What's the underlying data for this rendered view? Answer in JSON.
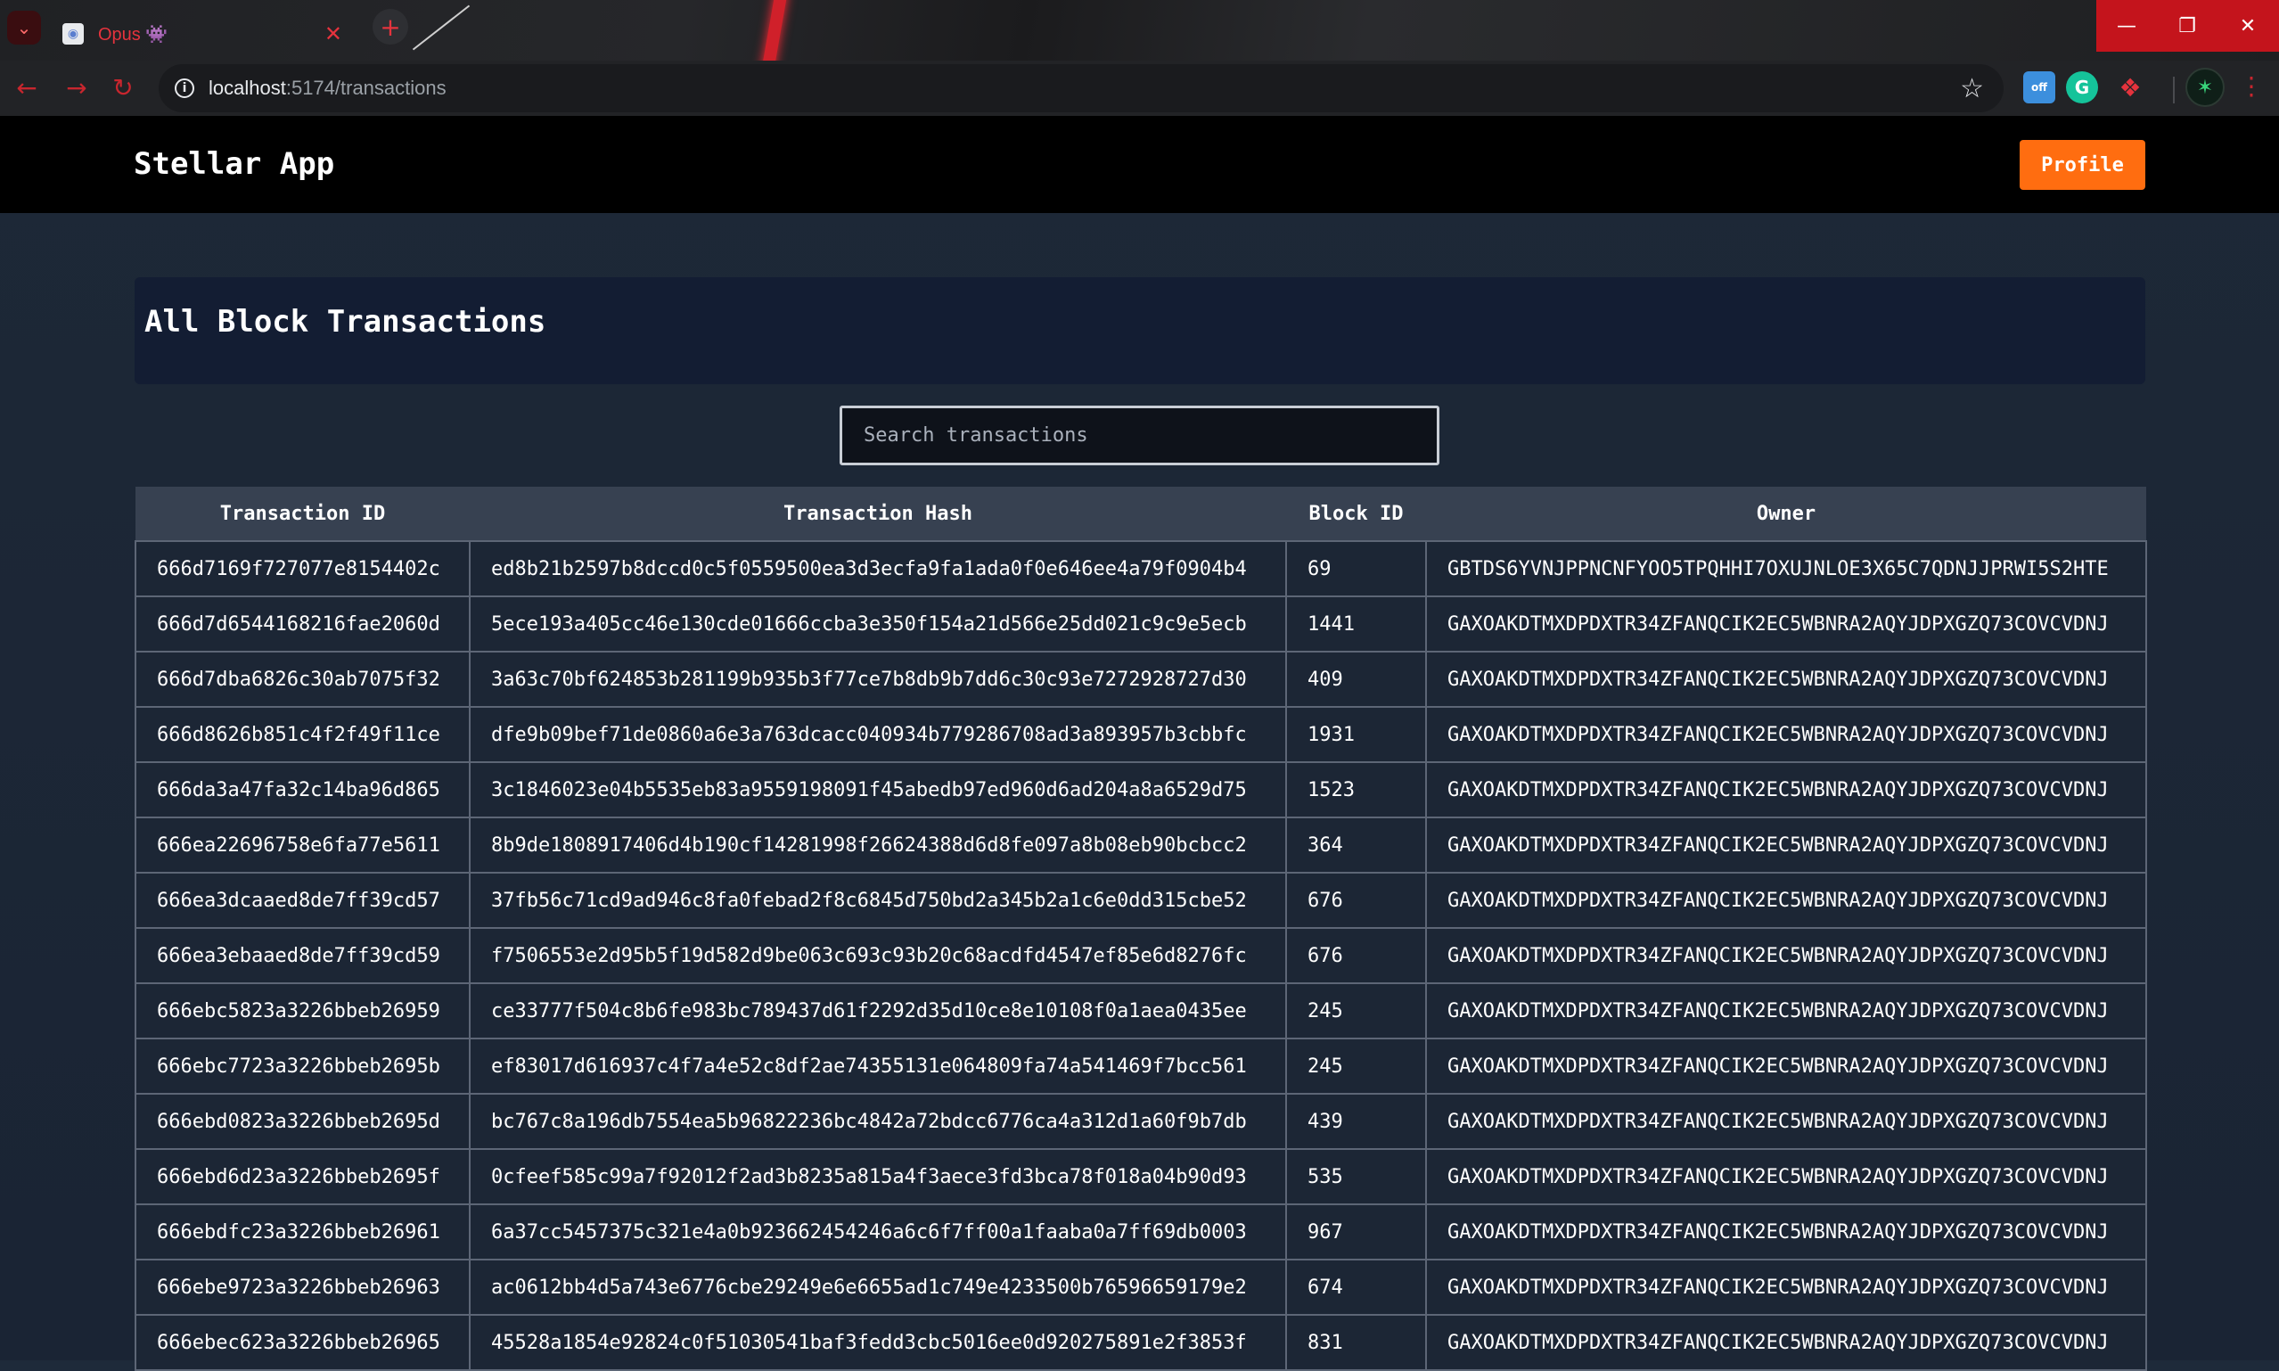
{
  "browser": {
    "tab_title": "Opus 👾",
    "url_host": "localhost",
    "url_path": ":5174/transactions",
    "extension_badge": "off",
    "grammarly_letter": "G"
  },
  "header": {
    "brand": "Stellar App",
    "profile_label": "Profile"
  },
  "page": {
    "title": "All Block Transactions",
    "search_placeholder": "Search transactions"
  },
  "table": {
    "columns": [
      "Transaction ID",
      "Transaction Hash",
      "Block ID",
      "Owner"
    ],
    "rows": [
      [
        "666d7169f727077e8154402c",
        "ed8b21b2597b8dccd0c5f0559500ea3d3ecfa9fa1ada0f0e646ee4a79f0904b4",
        "69",
        "GBTDS6YVNJPPNCNFYOO5TPQHHI7OXUJNLOE3X65C7QDNJJPRWI5S2HTE"
      ],
      [
        "666d7d6544168216fae2060d",
        "5ece193a405cc46e130cde01666ccba3e350f154a21d566e25dd021c9c9e5ecb",
        "1441",
        "GAXOAKDTMXDPDXTR34ZFANQCIK2EC5WBNRA2AQYJDPXGZQ73COVCVDNJ"
      ],
      [
        "666d7dba6826c30ab7075f32",
        "3a63c70bf624853b281199b935b3f77ce7b8db9b7dd6c30c93e7272928727d30",
        "409",
        "GAXOAKDTMXDPDXTR34ZFANQCIK2EC5WBNRA2AQYJDPXGZQ73COVCVDNJ"
      ],
      [
        "666d8626b851c4f2f49f11ce",
        "dfe9b09bef71de0860a6e3a763dcacc040934b779286708ad3a893957b3cbbfc",
        "1931",
        "GAXOAKDTMXDPDXTR34ZFANQCIK2EC5WBNRA2AQYJDPXGZQ73COVCVDNJ"
      ],
      [
        "666da3a47fa32c14ba96d865",
        "3c1846023e04b5535eb83a9559198091f45abedb97ed960d6ad204a8a6529d75",
        "1523",
        "GAXOAKDTMXDPDXTR34ZFANQCIK2EC5WBNRA2AQYJDPXGZQ73COVCVDNJ"
      ],
      [
        "666ea22696758e6fa77e5611",
        "8b9de1808917406d4b190cf14281998f26624388d6d8fe097a8b08eb90bcbcc2",
        "364",
        "GAXOAKDTMXDPDXTR34ZFANQCIK2EC5WBNRA2AQYJDPXGZQ73COVCVDNJ"
      ],
      [
        "666ea3dcaaed8de7ff39cd57",
        "37fb56c71cd9ad946c8fa0febad2f8c6845d750bd2a345b2a1c6e0dd315cbe52",
        "676",
        "GAXOAKDTMXDPDXTR34ZFANQCIK2EC5WBNRA2AQYJDPXGZQ73COVCVDNJ"
      ],
      [
        "666ea3ebaaed8de7ff39cd59",
        "f7506553e2d95b5f19d582d9be063c693c93b20c68acdfd4547ef85e6d8276fc",
        "676",
        "GAXOAKDTMXDPDXTR34ZFANQCIK2EC5WBNRA2AQYJDPXGZQ73COVCVDNJ"
      ],
      [
        "666ebc5823a3226bbeb26959",
        "ce33777f504c8b6fe983bc789437d61f2292d35d10ce8e10108f0a1aea0435ee",
        "245",
        "GAXOAKDTMXDPDXTR34ZFANQCIK2EC5WBNRA2AQYJDPXGZQ73COVCVDNJ"
      ],
      [
        "666ebc7723a3226bbeb2695b",
        "ef83017d616937c4f7a4e52c8df2ae74355131e064809fa74a541469f7bcc561",
        "245",
        "GAXOAKDTMXDPDXTR34ZFANQCIK2EC5WBNRA2AQYJDPXGZQ73COVCVDNJ"
      ],
      [
        "666ebd0823a3226bbeb2695d",
        "bc767c8a196db7554ea5b96822236bc4842a72bdcc6776ca4a312d1a60f9b7db",
        "439",
        "GAXOAKDTMXDPDXTR34ZFANQCIK2EC5WBNRA2AQYJDPXGZQ73COVCVDNJ"
      ],
      [
        "666ebd6d23a3226bbeb2695f",
        "0cfeef585c99a7f92012f2ad3b8235a815a4f3aece3fd3bca78f018a04b90d93",
        "535",
        "GAXOAKDTMXDPDXTR34ZFANQCIK2EC5WBNRA2AQYJDPXGZQ73COVCVDNJ"
      ],
      [
        "666ebdfc23a3226bbeb26961",
        "6a37cc5457375c321e4a0b923662454246a6c6f7ff00a1faaba0a7ff69db0003",
        "967",
        "GAXOAKDTMXDPDXTR34ZFANQCIK2EC5WBNRA2AQYJDPXGZQ73COVCVDNJ"
      ],
      [
        "666ebe9723a3226bbeb26963",
        "ac0612bb4d5a743e6776cbe29249e6e6655ad1c749e4233500b76596659179e2",
        "674",
        "GAXOAKDTMXDPDXTR34ZFANQCIK2EC5WBNRA2AQYJDPXGZQ73COVCVDNJ"
      ],
      [
        "666ebec623a3226bbeb26965",
        "45528a1854e92824c0f51030541baf3fedd3cbc5016ee0d920275891e2f3853f",
        "831",
        "GAXOAKDTMXDPDXTR34ZFANQCIK2EC5WBNRA2AQYJDPXGZQ73COVCVDNJ"
      ]
    ]
  },
  "theme": {
    "accent": "#ff6d10",
    "header_bg": "#000000",
    "page_bg": "#1e2a3a",
    "table_header_bg": "#374151",
    "browser_accent": "#c4141c"
  }
}
